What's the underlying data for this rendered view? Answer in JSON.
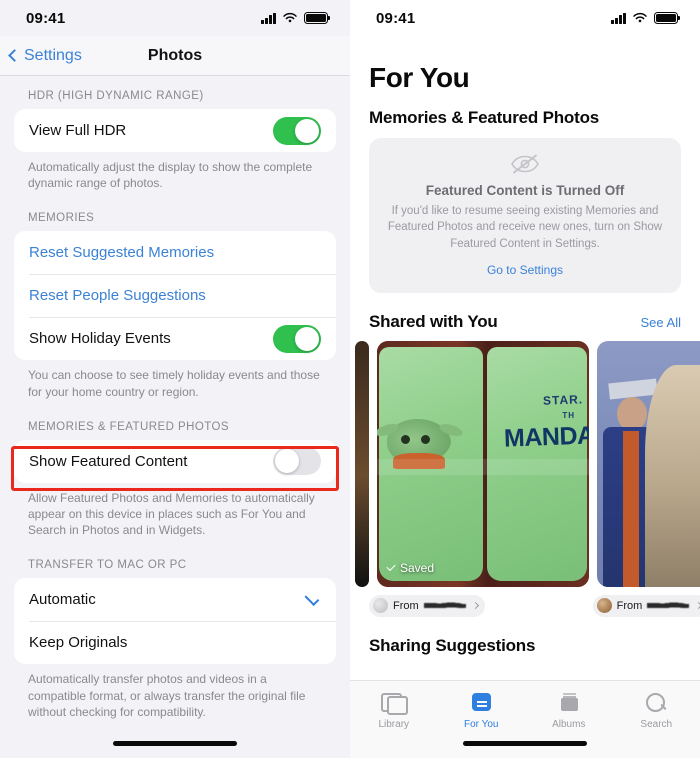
{
  "left_screen": {
    "status_bar": {
      "time": "09:41",
      "signal_icon": "cellular-signal-icon",
      "wifi_icon": "wifi-icon",
      "battery_icon": "battery-full-icon"
    },
    "nav": {
      "back_label": "Settings",
      "back_icon": "chevron-left-icon",
      "title": "Photos"
    },
    "sections": [
      {
        "header": "HDR (HIGH DYNAMIC RANGE)",
        "rows": [
          {
            "label": "View Full HDR",
            "control": "toggle",
            "state": "on"
          }
        ],
        "footnote": "Automatically adjust the display to show the complete dynamic range of photos."
      },
      {
        "header": "MEMORIES",
        "rows": [
          {
            "label": "Reset Suggested Memories",
            "control": "link"
          },
          {
            "label": "Reset People Suggestions",
            "control": "link"
          },
          {
            "label": "Show Holiday Events",
            "control": "toggle",
            "state": "on"
          }
        ],
        "footnote": "You can choose to see timely holiday events and those for your home country or region."
      },
      {
        "header": "MEMORIES & FEATURED PHOTOS",
        "rows": [
          {
            "label": "Show Featured Content",
            "control": "toggle",
            "state": "off",
            "highlighted": true
          }
        ],
        "footnote": "Allow Featured Photos and Memories to automatically appear on this device in places such as For You and Search in Photos and in Widgets."
      },
      {
        "header": "TRANSFER TO MAC OR PC",
        "rows": [
          {
            "label": "Automatic",
            "control": "checkmark",
            "selected": true
          },
          {
            "label": "Keep Originals",
            "control": "none",
            "selected": false
          }
        ],
        "footnote": "Automatically transfer photos and videos in a compatible format, or always transfer the original file without checking for compatibility."
      }
    ],
    "highlight_color": "#e8291c"
  },
  "right_screen": {
    "status_bar": {
      "time": "09:41",
      "signal_icon": "cellular-signal-icon",
      "wifi_icon": "wifi-icon",
      "battery_icon": "battery-full-icon"
    },
    "title": "For You",
    "memories_section": {
      "heading": "Memories & Featured Photos",
      "card": {
        "icon": "eye-slash-icon",
        "title": "Featured Content is Turned Off",
        "body": "If you'd like to resume seeing existing Memories and Featured Photos and receive new ones, turn on Show Featured Content in Settings.",
        "link": "Go to Settings"
      }
    },
    "shared_section": {
      "heading": "Shared with You",
      "see_all": "See All",
      "items": [
        {
          "badge": "Saved",
          "badge_icon": "checkmark-icon",
          "from_label": "From",
          "from_name_redacted": true,
          "avatar": "contact-avatar-gray",
          "chevron": "chevron-right-icon"
        },
        {
          "from_label": "From",
          "from_name_redacted": true,
          "avatar": "contact-avatar-brown",
          "chevron": "chevron-right-icon"
        }
      ]
    },
    "next_section_heading": "Sharing Suggestions",
    "tab_bar": {
      "tabs": [
        {
          "label": "Library",
          "icon": "photo-stack-icon",
          "active": false
        },
        {
          "label": "For You",
          "icon": "for-you-card-icon",
          "active": true
        },
        {
          "label": "Albums",
          "icon": "albums-icon",
          "active": false
        },
        {
          "label": "Search",
          "icon": "search-icon",
          "active": false
        }
      ],
      "active_color": "#2f7fe0"
    }
  }
}
